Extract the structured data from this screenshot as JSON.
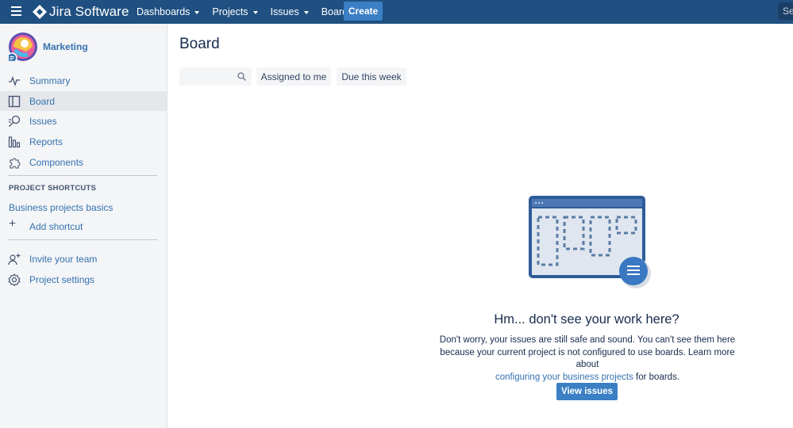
{
  "topnav": {
    "product": "Jira Software",
    "menus": [
      "Dashboards",
      "Projects",
      "Issues",
      "Boards"
    ],
    "create_label": "Create",
    "search_placeholder": "Se"
  },
  "sidebar": {
    "project_name": "Marketing",
    "items": [
      {
        "label": "Summary",
        "icon": "activity-icon"
      },
      {
        "label": "Board",
        "icon": "board-icon",
        "selected": true
      },
      {
        "label": "Issues",
        "icon": "issues-search-icon"
      },
      {
        "label": "Reports",
        "icon": "reports-chart-icon"
      },
      {
        "label": "Components",
        "icon": "puzzle-icon"
      }
    ],
    "shortcuts_title": "PROJECT SHORTCUTS",
    "shortcut_link": "Business projects basics",
    "add_shortcut": "Add shortcut",
    "invite": "Invite your team",
    "settings": "Project settings"
  },
  "main": {
    "title": "Board",
    "filters": [
      "Assigned to me",
      "Due this week"
    ],
    "empty": {
      "heading": "Hm... don't see your work here?",
      "line1": "Don't worry, your issues are still safe and sound. You can't see them here",
      "line2": "because your current project is not configured to use boards. Learn more about",
      "link": "configuring your business projects",
      "suffix": " for boards.",
      "button": "View issues"
    }
  },
  "colors": {
    "topnav_bg": "#205081",
    "primary_button": "#3b7fc4",
    "link": "#3572b0",
    "sidebar_bg": "#f4f5f7"
  }
}
